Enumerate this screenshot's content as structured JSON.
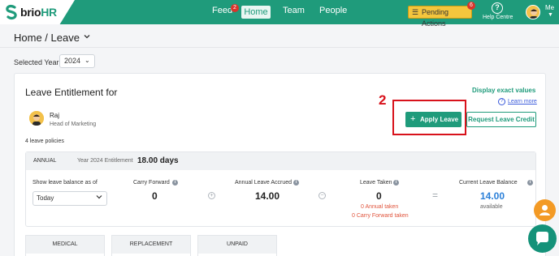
{
  "nav": {
    "logo_prefix": "brio",
    "logo_suffix": "HR",
    "feed": "Feed",
    "feed_badge": "2",
    "home": "Home",
    "team": "Team",
    "people": "People",
    "pending": "Pending Actions",
    "pending_badge": "6",
    "help": "Help Centre",
    "me": "Me"
  },
  "breadcrumb": {
    "text": "Home /  Leave"
  },
  "year": {
    "label": "Selected Year",
    "value": "2024"
  },
  "entitlement": {
    "title": "Leave Entitlement for",
    "display_exact": "Display exact values",
    "learn_more": "Learn more",
    "employee_name": "Raj",
    "employee_role": "Head of Marketing",
    "policies": "4 leave policies",
    "apply_label": "Apply Leave",
    "credit_label": "Request Leave Credit"
  },
  "annotation": {
    "step": "2"
  },
  "annual": {
    "title": "ANNUAL",
    "ent_label": "Year 2024 Entitlement",
    "ent_value": "18.00 days",
    "show_label": "Show leave balance as of",
    "show_value": "Today",
    "carry_label": "Carry Forward",
    "carry_value": "0",
    "accrued_label": "Annual Leave Accrued",
    "accrued_value": "14.00",
    "taken_label": "Leave Taken",
    "taken_value": "0",
    "taken_note1": "0 Annual taken",
    "taken_note2": "0 Carry Forward taken",
    "balance_label": "Current Leave Balance",
    "balance_value": "14.00",
    "balance_note": "available"
  },
  "tabs": [
    "MEDICAL",
    "REPLACEMENT",
    "UNPAID"
  ],
  "colors": {
    "brand": "#1f9b7b",
    "pending": "#f4c63d",
    "annotation": "#d8121b",
    "balance": "#2a7fd8"
  }
}
